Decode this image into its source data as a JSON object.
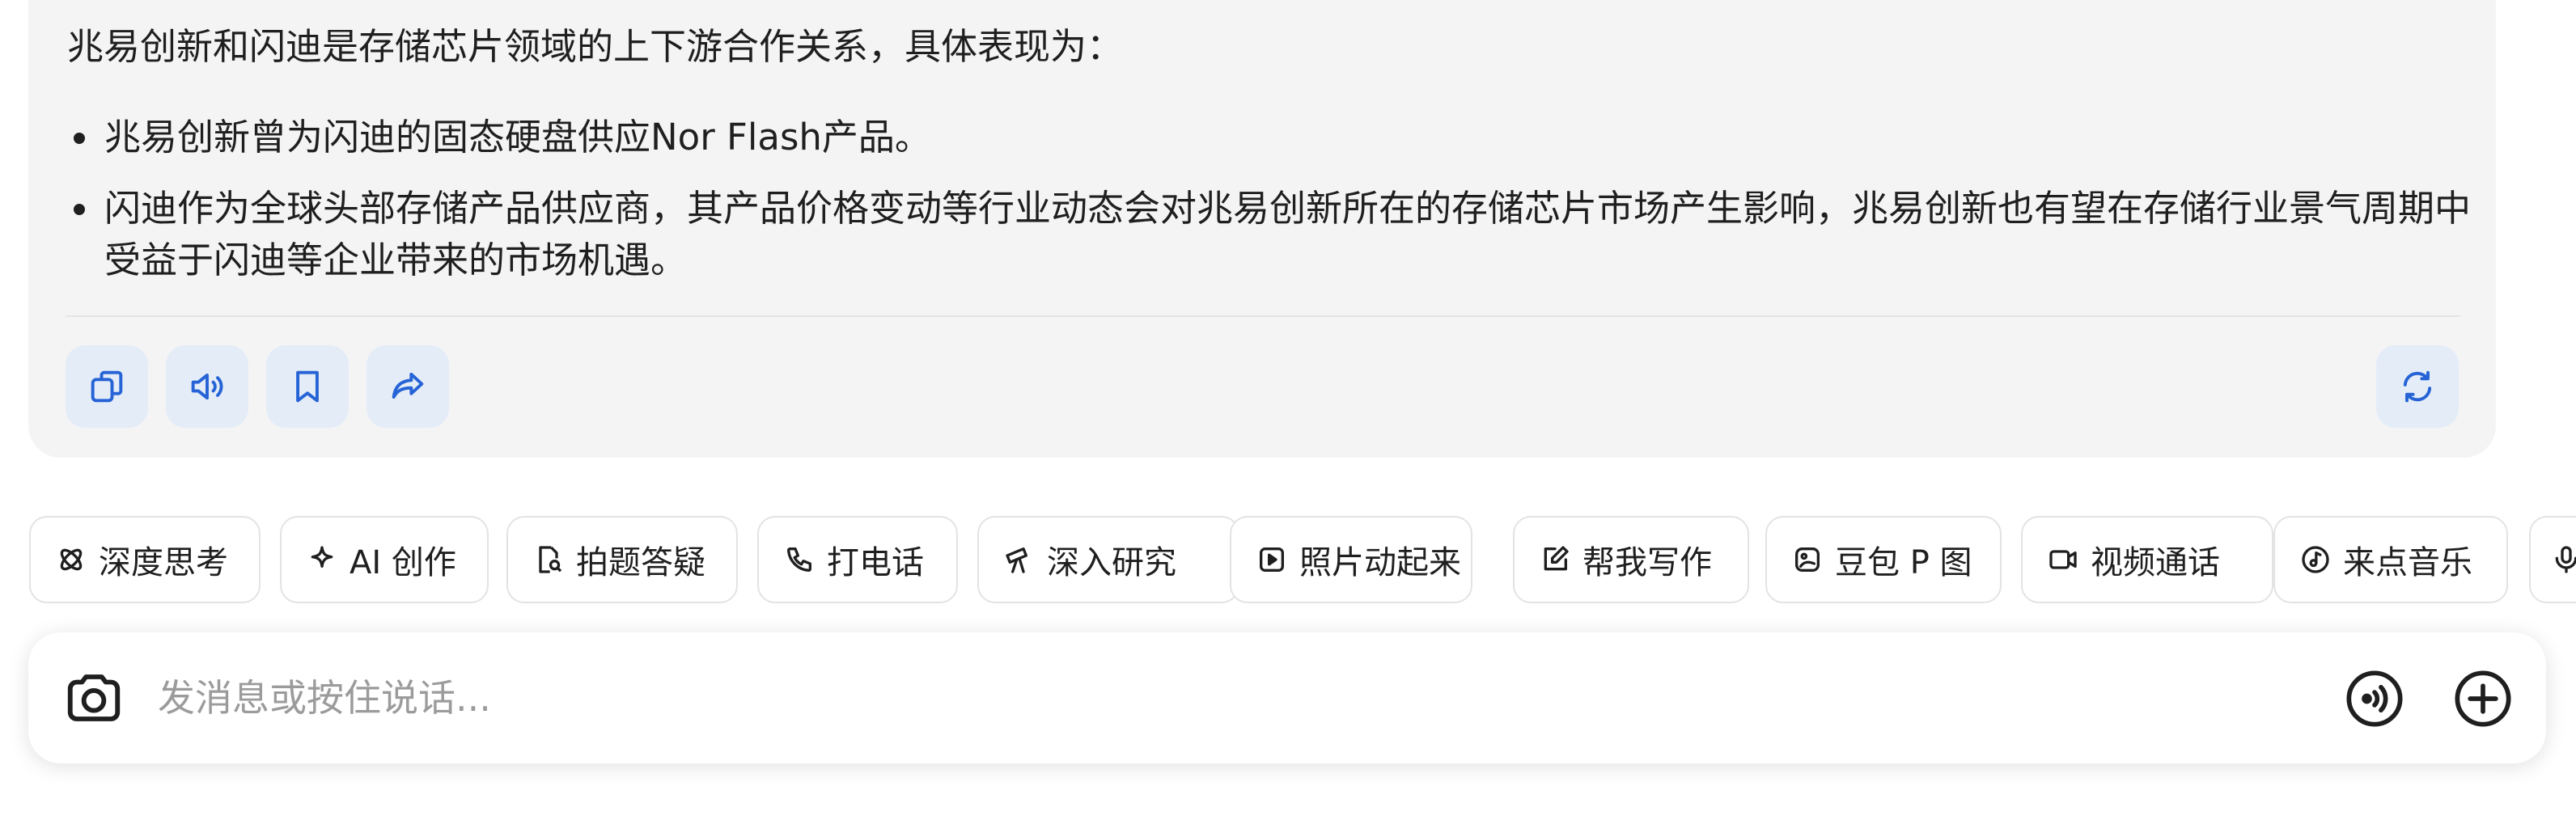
{
  "answer": {
    "intro": "兆易创新和闪迪是存储芯片领域的上下游合作关系，具体表现为：",
    "bullets": [
      "兆易创新曾为闪迪的固态硬盘供应Nor Flash产品。",
      "闪迪作为全球头部存储产品供应商，其产品价格变动等行业动态会对兆易创新所在的存储芯片市场产生影响，兆易创新也有望在存储行业景气周期中受益于闪迪等企业带来的市场机遇。"
    ]
  },
  "actions": [
    {
      "icon": "copy-icon"
    },
    {
      "icon": "speaker-icon"
    },
    {
      "icon": "bookmark-icon"
    },
    {
      "icon": "share-icon"
    },
    {
      "icon": "regenerate-icon"
    }
  ],
  "quick_actions": [
    {
      "label": "深度思考",
      "icon": "deep-think-icon"
    },
    {
      "label": "AI 创作",
      "icon": "sparkle-icon"
    },
    {
      "label": "拍题答疑",
      "icon": "photo-question-icon"
    },
    {
      "label": "打电话",
      "icon": "phone-icon"
    },
    {
      "label": "深入研究",
      "icon": "telescope-icon"
    },
    {
      "label": "照片动起来",
      "icon": "play-photo-icon"
    },
    {
      "label": "帮我写作",
      "icon": "edit-icon"
    },
    {
      "label": "豆包 P 图",
      "icon": "image-edit-icon"
    },
    {
      "label": "视频通话",
      "icon": "video-icon"
    },
    {
      "label": "来点音乐",
      "icon": "music-icon"
    },
    {
      "label": "",
      "icon": "microphone-icon"
    }
  ],
  "input": {
    "placeholder": "发消息或按住说话...",
    "icons": [
      "camera-icon",
      "voice-call-icon",
      "plus-icon"
    ]
  },
  "colors": {
    "accent_blue": "#2563d6",
    "action_button_bg": "#e4ecf8",
    "card_bg": "#f4f4f5",
    "placeholder_text": "#9b9b9b"
  }
}
